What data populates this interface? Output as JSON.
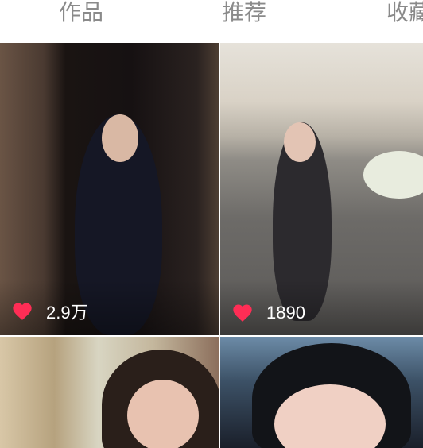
{
  "tabs": [
    {
      "label": "作品"
    },
    {
      "label": "推荐"
    },
    {
      "label": "收藏"
    }
  ],
  "grid": {
    "items": [
      {
        "likes": "2.9万"
      },
      {
        "likes": "1890"
      },
      {},
      {}
    ]
  },
  "colors": {
    "heart": "#ff2d55",
    "tab_text": "#8a8a8a"
  },
  "icons": {
    "like": "heart-icon"
  }
}
